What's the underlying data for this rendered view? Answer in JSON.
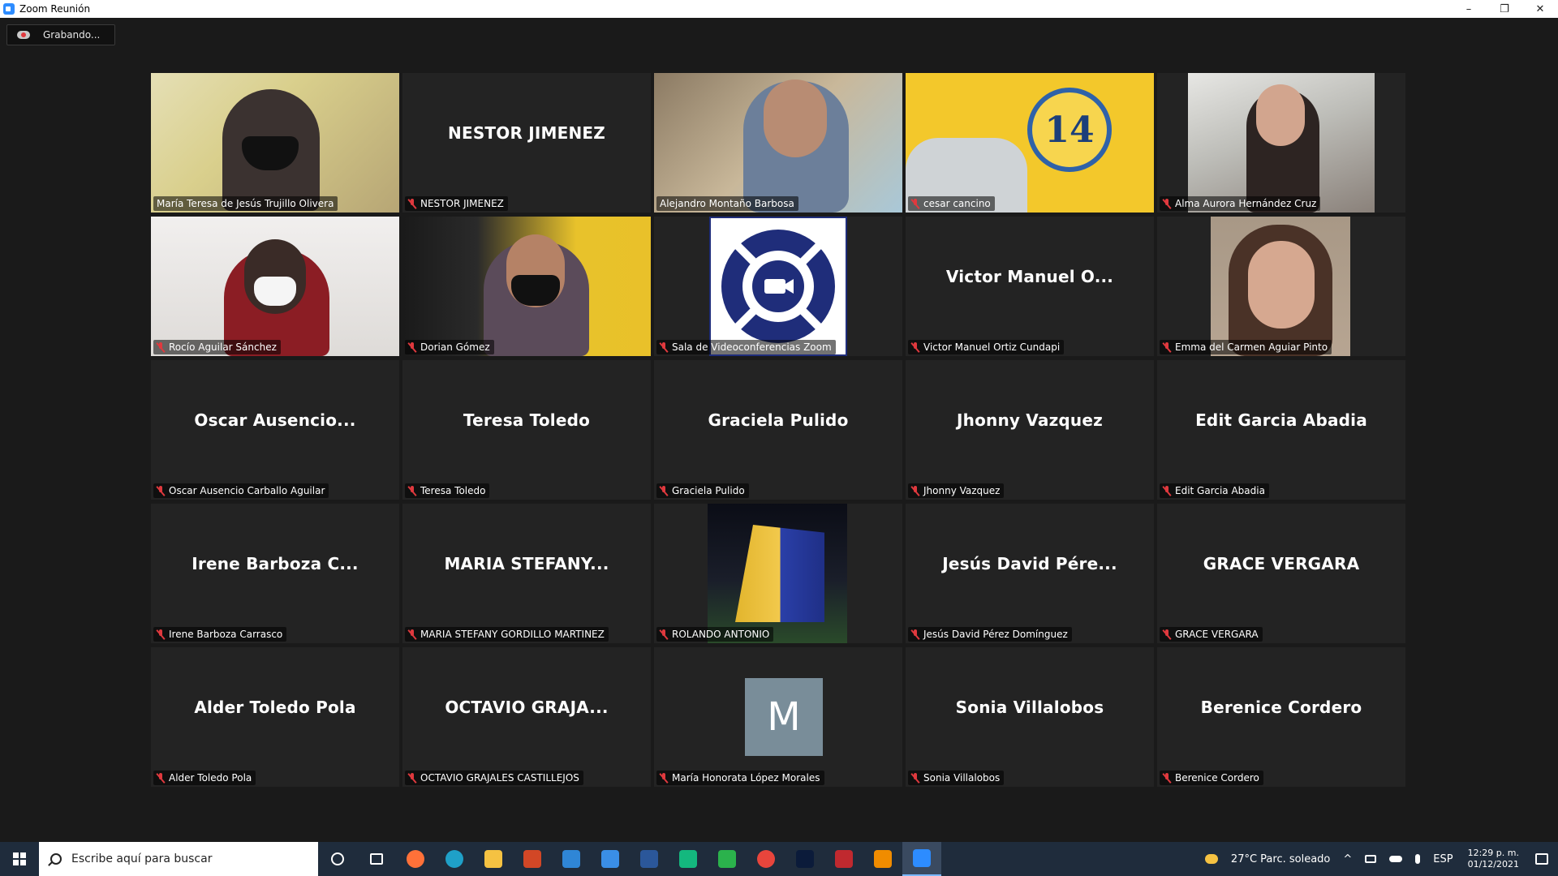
{
  "window": {
    "title": "Zoom Reunión",
    "minimize": "–",
    "restore": "❐",
    "close": "✕"
  },
  "recording": {
    "label": "Grabando..."
  },
  "participants": [
    {
      "tag": "María Teresa de Jesús Trujillo Olivera",
      "big": "",
      "muted": false,
      "active": true
    },
    {
      "tag": "NESTOR JIMENEZ",
      "big": "NESTOR JIMENEZ",
      "muted": true
    },
    {
      "tag": "Alejandro Montaño Barbosa",
      "big": "",
      "muted": false
    },
    {
      "tag": "cesar cancino",
      "big": "",
      "muted": true,
      "badge": "14"
    },
    {
      "tag": "Alma Aurora Hernández Cruz",
      "big": "",
      "muted": true
    },
    {
      "tag": "Rocío Aguilar Sánchez",
      "big": "",
      "muted": true
    },
    {
      "tag": "Dorian Gómez",
      "big": "",
      "muted": true
    },
    {
      "tag": "Sala de Videoconferencias Zoom",
      "big": "",
      "muted": true
    },
    {
      "tag": "Victor Manuel Ortiz Cundapi",
      "big": "Victor Manuel O...",
      "muted": true
    },
    {
      "tag": "Emma del Carmen Aguiar Pinto",
      "big": "",
      "muted": true
    },
    {
      "tag": "Oscar Ausencio Carballo Aguilar",
      "big": "Oscar  Ausencio...",
      "muted": true
    },
    {
      "tag": "Teresa Toledo",
      "big": "Teresa Toledo",
      "muted": true
    },
    {
      "tag": "Graciela Pulido",
      "big": "Graciela Pulido",
      "muted": true
    },
    {
      "tag": "Jhonny Vazquez",
      "big": "Jhonny Vazquez",
      "muted": true
    },
    {
      "tag": "Edit Garcia Abadia",
      "big": "Edit Garcia Abadia",
      "muted": true
    },
    {
      "tag": "Irene Barboza Carrasco",
      "big": "Irene Barboza C...",
      "muted": true
    },
    {
      "tag": "MARIA STEFANY GORDILLO MARTINEZ",
      "big": "MARIA  STEFANY...",
      "muted": true
    },
    {
      "tag": "ROLANDO ANTONIO",
      "big": "",
      "muted": true
    },
    {
      "tag": "Jesús David Pérez Domínguez",
      "big": "Jesús David Pére...",
      "muted": true
    },
    {
      "tag": "GRACE VERGARA",
      "big": "GRACE VERGARA",
      "muted": true
    },
    {
      "tag": "Alder Toledo Pola",
      "big": "Alder Toledo Pola",
      "muted": true
    },
    {
      "tag": "OCTAVIO GRAJALES CASTILLEJOS",
      "big": "OCTAVIO  GRAJA...",
      "muted": true
    },
    {
      "tag": "María Honorata López Morales",
      "big": "",
      "muted": true,
      "avatar": "M"
    },
    {
      "tag": "Sonia Villalobos",
      "big": "Sonia Villalobos",
      "muted": true
    },
    {
      "tag": "Berenice Cordero",
      "big": "Berenice Cordero",
      "muted": true
    }
  ],
  "taskbar": {
    "search_placeholder": "Escribe aquí para buscar",
    "apps": [
      {
        "icon": "cortana-icon",
        "color": "#1f2c3c"
      },
      {
        "icon": "task-view-icon",
        "color": "#1f2c3c"
      },
      {
        "icon": "firefox-icon",
        "color": "#ff7139"
      },
      {
        "icon": "edge-icon",
        "color": "#1fa0c8"
      },
      {
        "icon": "file-explorer-icon",
        "color": "#f5c242"
      },
      {
        "icon": "powerpoint-icon",
        "color": "#d24726"
      },
      {
        "icon": "mail-icon",
        "color": "#2f86d6"
      },
      {
        "icon": "store-icon",
        "color": "#3a8ee6"
      },
      {
        "icon": "word-icon",
        "color": "#2b579a"
      },
      {
        "icon": "terminal-icon",
        "color": "#14b87e"
      },
      {
        "icon": "phone-icon",
        "color": "#2bb24c"
      },
      {
        "icon": "chrome-icon",
        "color": "#e8453c"
      },
      {
        "icon": "photoshop-icon",
        "color": "#0b1b3a"
      },
      {
        "icon": "pdf-icon",
        "color": "#c0292f"
      },
      {
        "icon": "vlc-icon",
        "color": "#f08c00"
      },
      {
        "icon": "zoom-icon",
        "color": "#2d8cff"
      }
    ],
    "weather": "27°C  Parc. soleado",
    "language": "ESP",
    "time": "12:29 p. m.",
    "date": "01/12/2021"
  }
}
